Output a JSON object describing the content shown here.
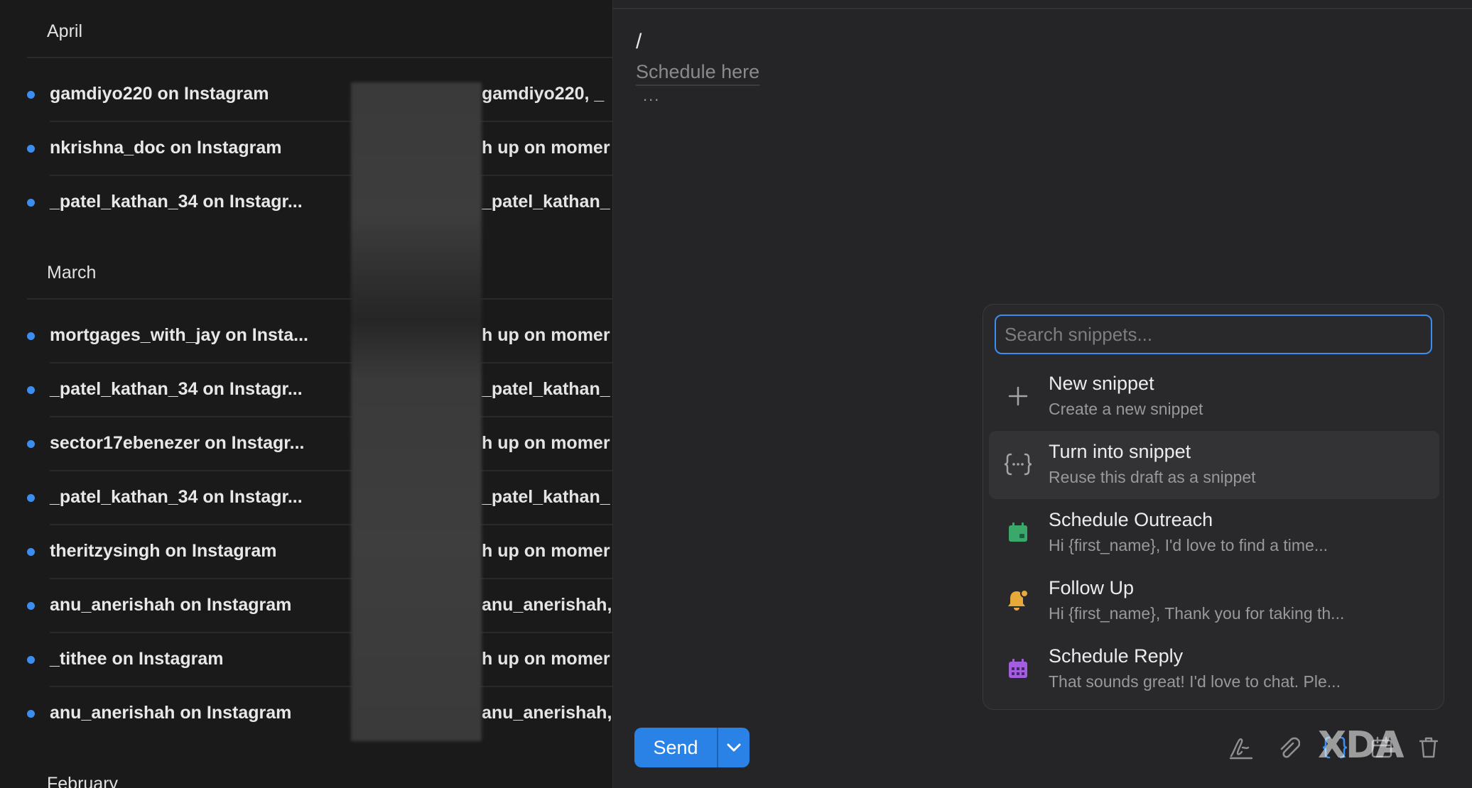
{
  "inbox": {
    "sections": [
      {
        "label": "April",
        "rows": [
          {
            "name": "gamdiyo220 on Instagram",
            "preview": "gamdiyo220, _"
          },
          {
            "name": "nkrishna_doc on Instagram",
            "preview": "h up on momer"
          },
          {
            "name": "_patel_kathan_34 on Instagr...",
            "preview": "_patel_kathan_"
          }
        ]
      },
      {
        "label": "March",
        "rows": [
          {
            "name": "mortgages_with_jay on Insta...",
            "preview": "h up on momer"
          },
          {
            "name": "_patel_kathan_34 on Instagr...",
            "preview": "_patel_kathan_"
          },
          {
            "name": "sector17ebenezer on Instagr...",
            "preview": "h up on momer"
          },
          {
            "name": "_patel_kathan_34 on Instagr...",
            "preview": "_patel_kathan_"
          },
          {
            "name": "theritzysingh on Instagram",
            "preview": "h up on momer"
          },
          {
            "name": "anu_anerishah on Instagram",
            "preview": "anu_anerishah,"
          },
          {
            "name": "_tithee on Instagram",
            "preview": "h up on momer"
          },
          {
            "name": "anu_anerishah on Instagram",
            "preview": "anu_anerishah,"
          }
        ]
      },
      {
        "label": "February",
        "rows": []
      }
    ]
  },
  "composer": {
    "typed_text": "/",
    "placeholder": "Schedule here",
    "ellipsis": "...",
    "send_label": "Send"
  },
  "snippets": {
    "search_placeholder": "Search snippets...",
    "items": [
      {
        "icon": "plus-icon",
        "title": "New snippet",
        "subtitle": "Create a new snippet"
      },
      {
        "icon": "braces-icon",
        "title": "Turn into snippet",
        "subtitle": "Reuse this draft as a snippet",
        "active": true
      },
      {
        "icon": "calendar-icon",
        "title": "Schedule Outreach",
        "subtitle": "Hi {first_name}, I'd love to find a time...",
        "color": "#3aa86b"
      },
      {
        "icon": "bell-icon",
        "title": "Follow Up",
        "subtitle": "Hi {first_name}, Thank you for taking th...",
        "color": "#e8a93a"
      },
      {
        "icon": "calendar-grid-icon",
        "title": "Schedule Reply",
        "subtitle": "That sounds great! I'd love to chat. Ple...",
        "color": "#a25de0"
      }
    ]
  },
  "watermark": "XDA",
  "colors": {
    "accent": "#3b8ef0",
    "send_button": "#2b82e6",
    "panel_bg": "#252527",
    "list_bg": "#1a1a1b"
  }
}
